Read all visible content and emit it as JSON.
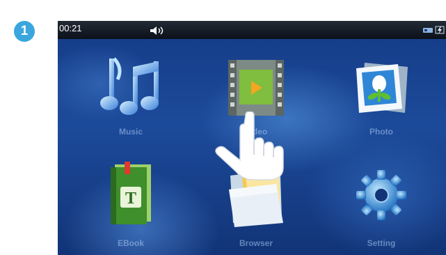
{
  "step": {
    "number": "1"
  },
  "status_bar": {
    "time": "00:21",
    "volume_icon": "speaker-icon",
    "usb_icon": "usb-connection-icon",
    "battery_icon": "battery-charging-icon"
  },
  "apps": [
    {
      "label": "Music",
      "icon": "music-notes-icon"
    },
    {
      "label": "Video",
      "icon": "film-strip-icon"
    },
    {
      "label": "Photo",
      "icon": "photo-flower-icon"
    },
    {
      "label": "EBook",
      "icon": "book-icon"
    },
    {
      "label": "Browser",
      "icon": "folder-icon"
    },
    {
      "label": "Setting",
      "icon": "gear-icon"
    }
  ],
  "colors": {
    "badge": "#3aa6dd",
    "screen_bg": "#1c4a9a",
    "status_bar_bg": "#0c1119"
  },
  "pointer": {
    "icon": "pointing-hand-icon"
  }
}
